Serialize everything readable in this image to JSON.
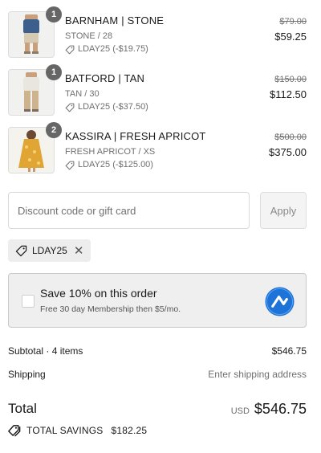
{
  "items": [
    {
      "quantity": "1",
      "name": "BARNHAM | STONE",
      "variant": "STONE / 28",
      "discount": "LDAY25 (-$19.75)",
      "original_price": "$79.00",
      "price": "$59.25"
    },
    {
      "quantity": "1",
      "name": "BATFORD | TAN",
      "variant": "TAN / 30",
      "discount": "LDAY25 (-$37.50)",
      "original_price": "$150.00",
      "price": "$112.50"
    },
    {
      "quantity": "2",
      "name": "KASSIRA | FRESH APRICOT",
      "variant": "FRESH APRICOT / XS",
      "discount": "LDAY25 (-$125.00)",
      "original_price": "$500.00",
      "price": "$375.00"
    }
  ],
  "discount_form": {
    "placeholder": "Discount code or gift card",
    "value": "",
    "apply_label": "Apply"
  },
  "applied_code": "LDAY25",
  "membership": {
    "title": "Save 10% on this order",
    "subtitle": "Free 30 day Membership then $5/mo.",
    "checked": false,
    "logo_color": "#1e73d9"
  },
  "summary": {
    "subtotal_label": "Subtotal · 4 items",
    "subtotal_value": "$546.75",
    "shipping_label": "Shipping",
    "shipping_value": "Enter shipping address",
    "total_label": "Total",
    "currency": "USD",
    "total_value": "$546.75",
    "savings_label": "TOTAL SAVINGS",
    "savings_value": "$182.25"
  },
  "icons": {
    "discount_tag": "tag-icon",
    "remove": "close-icon",
    "savings": "tags-icon"
  }
}
